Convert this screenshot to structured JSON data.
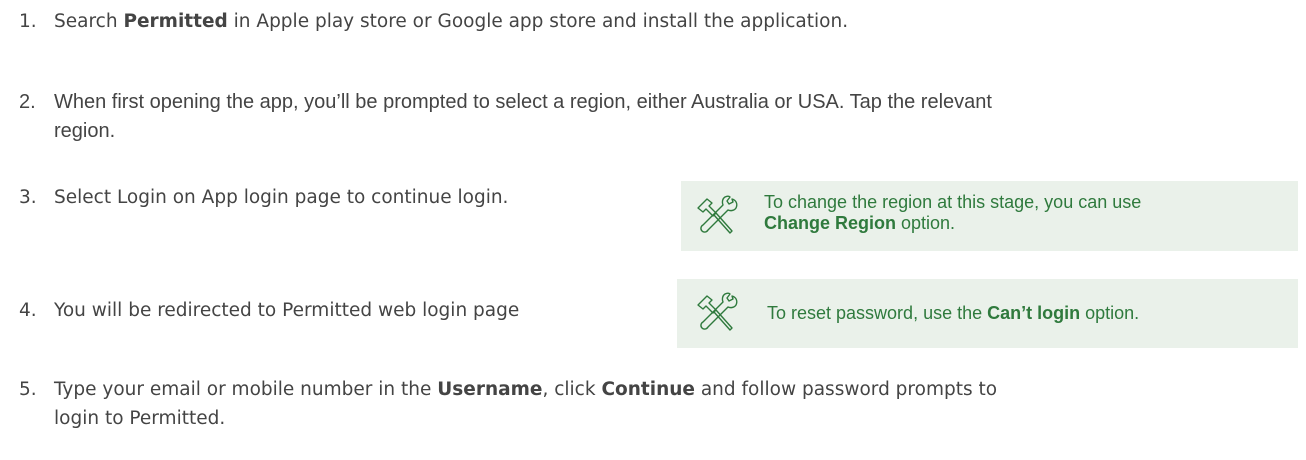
{
  "steps": [
    {
      "num": "1.",
      "before": "Search ",
      "bold": "Permitted",
      "after": " in Apple play store or Google app store and install the application."
    },
    {
      "num": "2.",
      "line1": "When first opening the app, you’ll be prompted to select a region, either Australia or USA. Tap the relevant",
      "line2": "region."
    },
    {
      "num": "3.",
      "text": "Select Login on App login page to continue login."
    },
    {
      "num": "4.",
      "text": "You will be redirected to Permitted web login page"
    },
    {
      "num": "5.",
      "l1_a": "Type your email or mobile number in the ",
      "l1_b": "Username",
      "l1_c": ", click ",
      "l1_d": "Continue",
      "l1_e": " and follow password prompts to",
      "line2": "login to Permitted."
    }
  ],
  "tips": [
    {
      "line1": "To change the region at this stage, you can use",
      "bold": "Change Region",
      "after": " option.",
      "icon": "tools-icon"
    },
    {
      "before": "To reset password, use the ",
      "bold": "Can’t login",
      "after": " option.",
      "icon": "tools-icon"
    }
  ],
  "colors": {
    "text": "#444444",
    "tip_text": "#2f7a3d",
    "tip_bg": "#eaf1ea",
    "icon": "#2f7a3d"
  }
}
